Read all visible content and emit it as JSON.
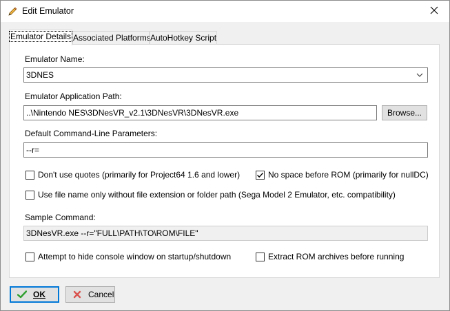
{
  "window": {
    "title": "Edit Emulator",
    "icon": "pencil-icon",
    "close_icon": "close-icon"
  },
  "tabs": [
    {
      "label": "Emulator Details",
      "active": true
    },
    {
      "label": "Associated Platforms",
      "active": false
    },
    {
      "label": "AutoHotkey Script",
      "active": false
    }
  ],
  "form": {
    "emulator_name_label": "Emulator Name:",
    "emulator_name_value": "3DNES",
    "app_path_label": "Emulator Application Path:",
    "app_path_value": "..\\Nintendo NES\\3DNesVR_v2.1\\3DNesVR\\3DNesVR.exe",
    "browse_label": "Browse...",
    "params_label": "Default Command-Line Parameters:",
    "params_value": "--r=",
    "options": {
      "dont_use_quotes": {
        "label": "Don't use quotes (primarily for Project64 1.6 and lower)",
        "checked": false
      },
      "no_space_before_rom": {
        "label": "No space before ROM (primarily for nullDC)",
        "checked": true
      },
      "file_name_only": {
        "label": "Use file name only without file extension or folder path (Sega Model 2 Emulator, etc. compatibility)",
        "checked": false
      },
      "hide_console": {
        "label": "Attempt to hide console window on startup/shutdown",
        "checked": false
      },
      "extract_rom": {
        "label": "Extract ROM archives before running",
        "checked": false
      }
    },
    "sample_command_label": "Sample Command:",
    "sample_command_value": "3DNesVR.exe --r=\"FULL\\PATH\\TO\\ROM\\FILE\""
  },
  "buttons": {
    "ok_label": "OK",
    "ok_icon": "checkmark-icon",
    "cancel_label": "Cancel",
    "cancel_icon": "cancel-x-icon"
  },
  "colors": {
    "accent": "#0078d7",
    "ok_green": "#2e9e2e",
    "cancel_red": "#d9534f"
  }
}
